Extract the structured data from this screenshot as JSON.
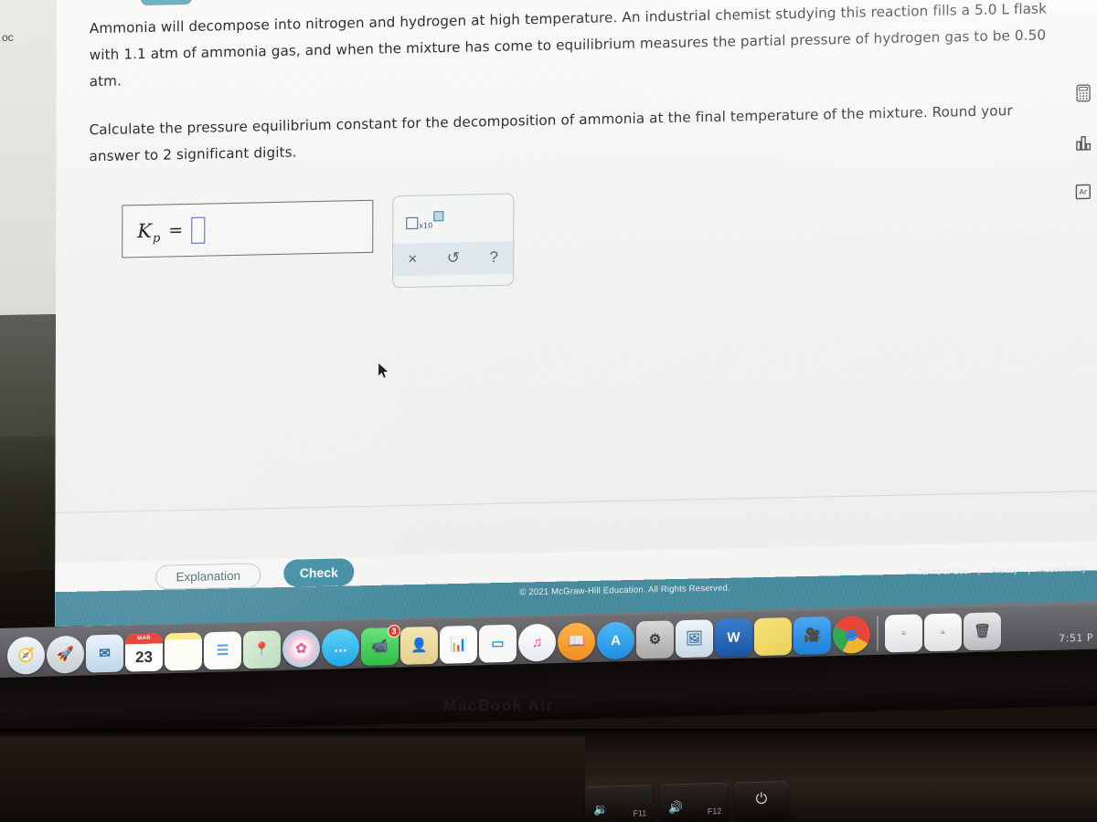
{
  "meta": {
    "device_label": "MacBook Air",
    "left_window_fragment": "oc",
    "clock": "7:51 P"
  },
  "question": {
    "collapse_icon": "chevron-down-icon",
    "paragraph_1": "Ammonia will decompose into nitrogen and hydrogen at high temperature. An industrial chemist studying this reaction fills a 5.0 L flask with 1.1 atm of ammonia gas, and when the mixture has come to equilibrium measures the partial pressure of hydrogen gas to be 0.50 atm.",
    "paragraph_2": "Calculate the pressure equilibrium constant for the decomposition of ammonia at the final temperature of the mixture. Round your answer to 2 significant digits.",
    "values": {
      "flask_volume": "5.0 L",
      "initial_ammonia_pressure": "1.1 atm",
      "hydrogen_partial_pressure": "0.50 atm",
      "significant_digits": "2"
    }
  },
  "answer": {
    "symbol": "K",
    "subscript": "p",
    "equals": "=",
    "input_value": "",
    "input_placeholder": ""
  },
  "palette": {
    "scientific_notation_label": "x10",
    "buttons": [
      {
        "name": "clear-button",
        "glyph": "×"
      },
      {
        "name": "undo-button",
        "glyph": "↺"
      },
      {
        "name": "help-button",
        "glyph": "?"
      }
    ]
  },
  "footer": {
    "explanation_label": "Explanation",
    "check_label": "Check",
    "copyright": "© 2021 McGraw-Hill Education. All Rights Reserved.",
    "links": [
      "Terms of Use",
      "Privacy",
      "Accessibility"
    ],
    "separator": "|"
  },
  "tool_rail": [
    {
      "name": "calculator-icon",
      "label": "Calculator"
    },
    {
      "name": "bar-chart-icon",
      "label": "Data chart"
    },
    {
      "name": "periodic-table-icon",
      "label": "Periodic table"
    }
  ],
  "colors": {
    "teal_accent": "#3e8ca2",
    "footer_bar": "#45899c",
    "chevron_button": "#6fb0c0",
    "input_outline": "#4a5fb0",
    "page_background": "#f2f2ef"
  },
  "dock": {
    "calendar_month": "MAR",
    "calendar_day": "23",
    "facetime_badge": "3",
    "items": [
      {
        "name": "dock-safari",
        "label": "Safari",
        "glyph": "🧭",
        "bg": "linear-gradient(180deg,#f2f6f9,#cfdce6)",
        "color": "#1a6fb5",
        "shape": "circle"
      },
      {
        "name": "dock-launchpad",
        "label": "Launchpad",
        "glyph": "🚀",
        "bg": "linear-gradient(180deg,#e9eef1,#c6ced4)",
        "color": "#566",
        "shape": "circle"
      },
      {
        "name": "dock-mail",
        "label": "Mail",
        "glyph": "✉",
        "bg": "linear-gradient(180deg,#eaf3fb,#bcd6ea)",
        "color": "#2a6ea8",
        "shape": "rect"
      },
      {
        "name": "dock-calendar",
        "label": "Calendar",
        "glyph": "",
        "bg": "#ffffff",
        "color": "#333",
        "shape": "calendar"
      },
      {
        "name": "dock-notes",
        "label": "Notes",
        "glyph": "",
        "bg": "linear-gradient(180deg,#fbe98a 0 18%,#fdfdf6 18%)",
        "color": "#444",
        "shape": "rect"
      },
      {
        "name": "dock-reminders",
        "label": "Reminders",
        "glyph": "☰",
        "bg": "#fbfbf7",
        "color": "#5aa0e0",
        "shape": "rect"
      },
      {
        "name": "dock-maps",
        "label": "Maps",
        "glyph": "📍",
        "bg": "linear-gradient(135deg,#dff0d8,#b9dcc0)",
        "color": "#d9534f",
        "shape": "rect"
      },
      {
        "name": "dock-photos",
        "label": "Photos",
        "glyph": "✿",
        "bg": "radial-gradient(circle,#ffffff 20%,#f5c6d6 45%,#9fd3f0 75%)",
        "color": "#e06aa0",
        "shape": "circle"
      },
      {
        "name": "dock-messages",
        "label": "Messages",
        "glyph": "…",
        "bg": "linear-gradient(180deg,#5ed0f5,#21a8e8)",
        "color": "#fff",
        "shape": "circle"
      },
      {
        "name": "dock-facetime",
        "label": "FaceTime",
        "glyph": "📹",
        "bg": "linear-gradient(180deg,#6de07a,#2bbf45)",
        "color": "#fff",
        "shape": "rect"
      },
      {
        "name": "dock-contacts",
        "label": "Contacts",
        "glyph": "👤",
        "bg": "linear-gradient(180deg,#f6e6b4,#e3cf8d)",
        "color": "#7a5a2a",
        "shape": "rect"
      },
      {
        "name": "dock-numbers",
        "label": "Numbers",
        "glyph": "📊",
        "bg": "#fbfbfb",
        "color": "#3aab4b",
        "shape": "rect"
      },
      {
        "name": "dock-keynote",
        "label": "Keynote",
        "glyph": "▭",
        "bg": "#f7f7f7",
        "color": "#2a9fd0",
        "shape": "rect"
      },
      {
        "name": "dock-itunes",
        "label": "iTunes",
        "glyph": "♫",
        "bg": "linear-gradient(180deg,#ffffff,#e8e8ee)",
        "color": "#e0408f",
        "shape": "circle"
      },
      {
        "name": "dock-books",
        "label": "Books",
        "glyph": "📖",
        "bg": "linear-gradient(180deg,#ffb347,#f28c20)",
        "color": "#fff",
        "shape": "circle"
      },
      {
        "name": "dock-appstore",
        "label": "App Store",
        "glyph": "A",
        "bg": "linear-gradient(180deg,#4fb8f5,#1d8fe0)",
        "color": "#fff",
        "shape": "circle"
      },
      {
        "name": "dock-system-preferences",
        "label": "System Preferences",
        "glyph": "⚙",
        "bg": "linear-gradient(180deg,#d8d8d8,#a8a8a8)",
        "color": "#3a3a3a",
        "shape": "rect"
      },
      {
        "name": "dock-preview",
        "label": "Preview",
        "glyph": "🖼",
        "bg": "linear-gradient(180deg,#eef4f8,#c8d8e4)",
        "color": "#4a7ea8",
        "shape": "rect"
      },
      {
        "name": "dock-word",
        "label": "Microsoft Word",
        "glyph": "W",
        "bg": "linear-gradient(180deg,#3b7ccc,#1b55a5)",
        "color": "#fff",
        "shape": "rect"
      },
      {
        "name": "dock-stickies",
        "label": "Stickies",
        "glyph": "",
        "bg": "linear-gradient(150deg,#f7e27a,#e9d15a)",
        "color": "#7a6a20",
        "shape": "rect"
      },
      {
        "name": "dock-zoom",
        "label": "Zoom",
        "glyph": "🎥",
        "bg": "linear-gradient(180deg,#4aa8f0,#1e7fd8)",
        "color": "#fff",
        "shape": "rect"
      },
      {
        "name": "dock-chrome",
        "label": "Google Chrome",
        "glyph": "◉",
        "bg": "conic-gradient(#e8453c 0 33%,#f2b233 33% 58%,#34a853 58% 83%,#e8453c 83%)",
        "color": "#2a7de1",
        "shape": "circle"
      }
    ],
    "minimized": [
      {
        "name": "dock-minimized-window-1",
        "label": "Minimized document window"
      },
      {
        "name": "dock-minimized-window-2",
        "label": "Minimized document window"
      }
    ],
    "trash": {
      "name": "dock-trash",
      "label": "Trash"
    }
  },
  "keyboard": {
    "keys": [
      {
        "name": "key-f11",
        "fn": "F11",
        "glyph": "🔉"
      },
      {
        "name": "key-f12",
        "fn": "F12",
        "glyph": "🔊"
      },
      {
        "name": "key-power",
        "fn": "",
        "glyph": "⏻"
      }
    ]
  }
}
